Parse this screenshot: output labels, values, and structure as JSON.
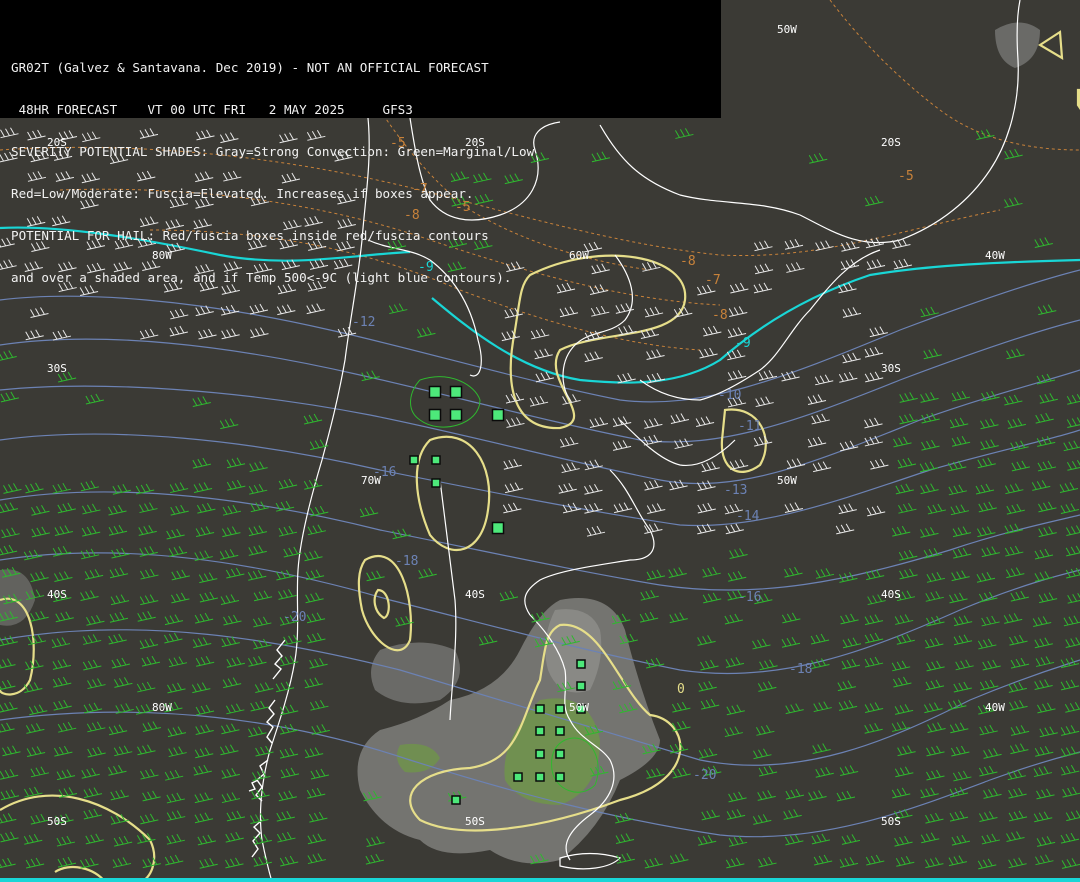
{
  "header": {
    "lines": [
      "GR02T (Galvez & Santavana. Dec 2019) - NOT AN OFFICIAL FORECAST",
      " 48HR FORECAST    VT 00 UTC FRI   2 MAY 2025     GFS3",
      "SEVERITY POTENTIAL SHADES: Gray=Strong Convection: Green=Marginal/Low",
      "Red=Low/Moderate: Fuscia=Elevated. Increases if boxes appear.",
      "POTENTIAL FOR HAIL: Red/fuscia boxes inside red/fuscia contours",
      "and over a shaded area, and if Temp 500<-9C (light blue contours)."
    ]
  },
  "grid_labels": {
    "lat": [
      "20S",
      "20S",
      "20S",
      "30S",
      "30S",
      "40S",
      "40S",
      "40S",
      "50S",
      "50S",
      "50S"
    ],
    "lon": [
      "50W",
      "60W",
      "40W",
      "80W",
      "70W",
      "50W",
      "80W",
      "40W",
      "50W"
    ]
  },
  "temperature_labels": {
    "blue": [
      "-9",
      "-10",
      "-11",
      "-12",
      "-13",
      "-14",
      "-16",
      "-16",
      "-18",
      "-18",
      "-20",
      "-20",
      "-9"
    ],
    "orange": [
      "-5",
      "-5",
      "-5",
      "-7",
      "-7",
      "-8",
      "-8",
      "-8"
    ],
    "yellow": [
      "0"
    ]
  },
  "colors": {
    "background": "#3b3a35",
    "coast": "#ffffff",
    "temp_contour": "#6c82b4",
    "zero_isotherm": "#19d6d6",
    "severity_contour": "#e6de8a",
    "green_wind_barb": "#2fb82f",
    "white_wind_barb": "#e8e8e8",
    "hail_box": "#4de87a",
    "gray_shade": "#8a8a88",
    "green_shade": "#6f9a45"
  }
}
